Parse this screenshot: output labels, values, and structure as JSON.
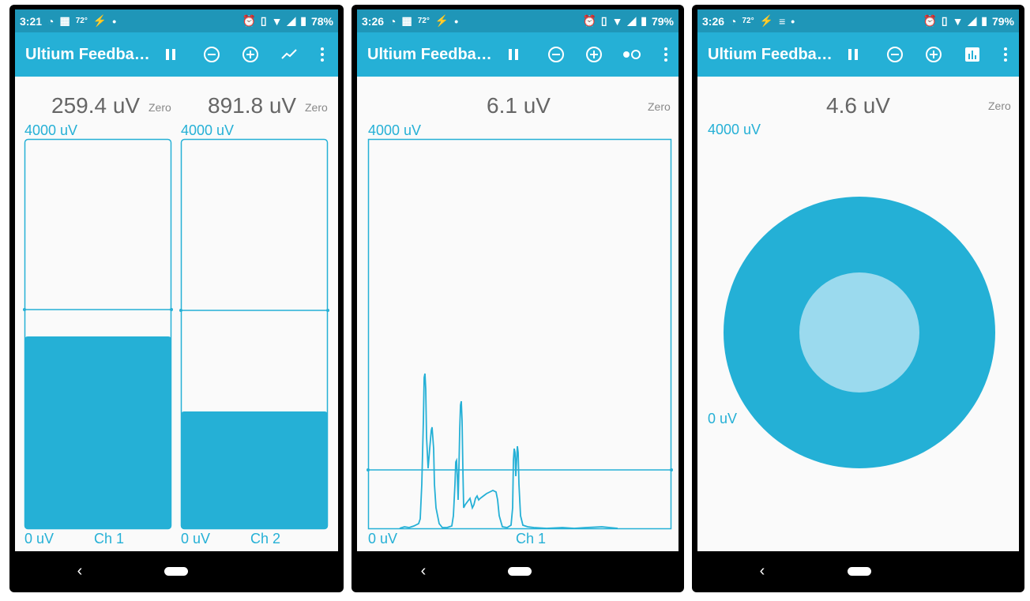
{
  "accent_color": "#25b0d6",
  "status_bar_color": "#1f96b8",
  "screens": [
    {
      "status": {
        "time": "3:21",
        "temp": "72°",
        "battery": "78%"
      },
      "toolbar": {
        "title": "Ultium Feedba…",
        "mode_icon": "line-chart-icon"
      },
      "channels": [
        {
          "value": "259.4 uV",
          "zero": "Zero",
          "max_label": "4000 uV",
          "min_label": "0 uV",
          "name": "Ch 1",
          "level_fraction": 0.5
        },
        {
          "value": "891.8 uV",
          "zero": "Zero",
          "max_label": "4000 uV",
          "min_label": "0 uV",
          "name": "Ch 2",
          "level_fraction": 0.3
        }
      ]
    },
    {
      "status": {
        "time": "3:26",
        "temp": "72°",
        "battery": "79%"
      },
      "toolbar": {
        "title": "Ultium Feedba…",
        "mode_icon": "dots-toggle-icon"
      },
      "value": "6.1 uV",
      "zero": "Zero",
      "max_label": "4000 uV",
      "min_label": "0 uV",
      "channel": "Ch 1",
      "threshold_fraction": 0.15
    },
    {
      "status": {
        "time": "3:26",
        "temp": "72°",
        "battery": "79%"
      },
      "toolbar": {
        "title": "Ultium Feedba…",
        "mode_icon": "bar-chart-icon"
      },
      "value": "4.6 uV",
      "zero": "Zero",
      "max_label": "4000 uV",
      "min_label": "0 uV",
      "inner_fraction": 0.44
    }
  ]
}
